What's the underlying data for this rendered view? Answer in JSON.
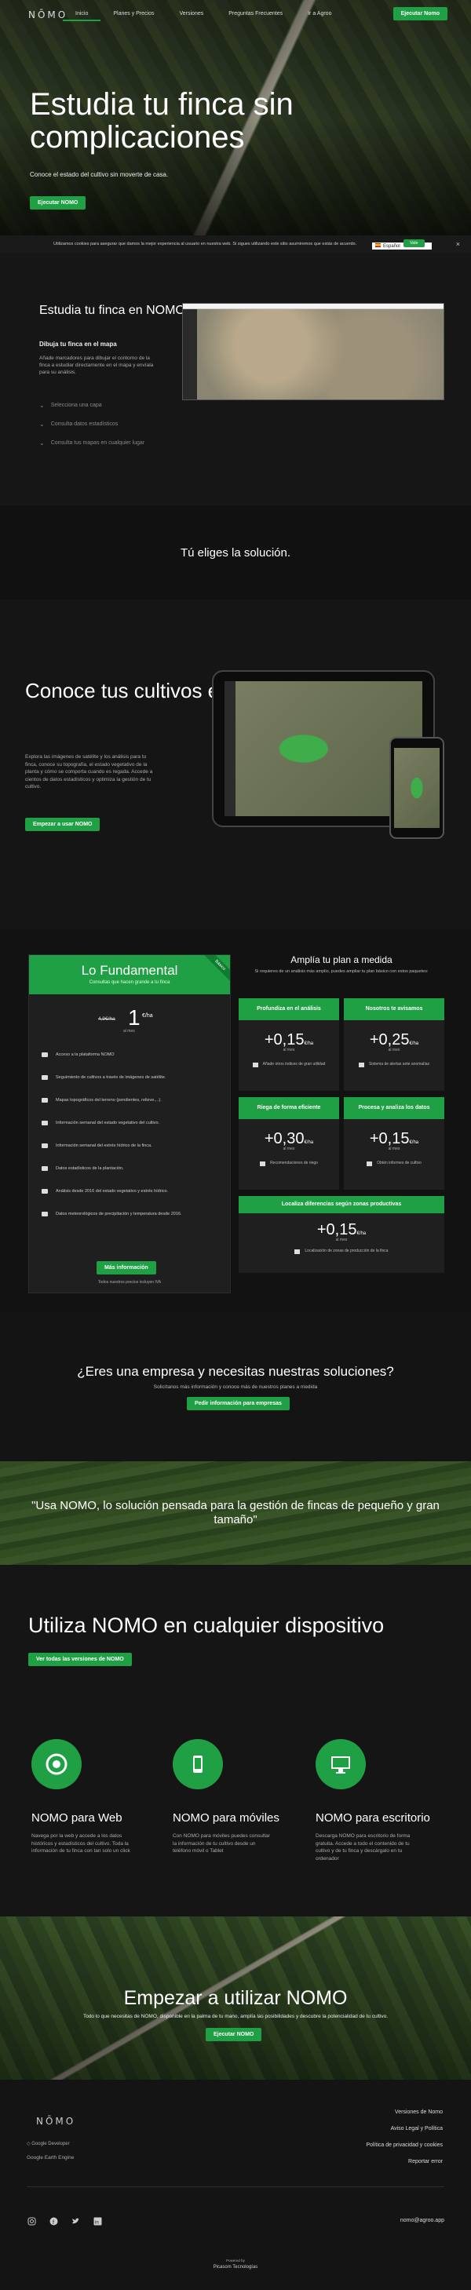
{
  "nav": {
    "logo": "NŌMO",
    "links": [
      "Inicio",
      "Planes y Precios",
      "Versiones",
      "Preguntas Frecuentes",
      "Ir a Agroo"
    ],
    "cta": "Ejecutar Nomo"
  },
  "hero": {
    "title": "Estudia tu finca sin complicaciones",
    "subtitle": "Conoce el estado del cultivo sin moverte de casa.",
    "cta": "Ejecutar NOMO"
  },
  "cookie": {
    "text": "Utilizamos cookies para asegurar que damos la mejor experiencia al usuario en nuestra web. Si sigues utilizando este sitio asumiremos que estás de acuerdo.",
    "accept": "Vale",
    "language": "Español",
    "close": "×"
  },
  "study": {
    "title": "Estudia tu finca en NOMO",
    "subtitle": "Dibuja tu finca en el mapa",
    "body": "Añade marcadores para dibujar el contorno de la finca a estudiar directamente en el mapa y envíala para su análisis.",
    "features": [
      "Selecciona una capa",
      "Consulta datos estadísticos",
      "Consulta tus mapas en cualquier lugar"
    ]
  },
  "tagline": "Tú eliges la solución.",
  "know": {
    "title": "Conoce tus cultivos en profundidad",
    "body": "Explora las imágenes de satélite y los análisis para tu finca, conoce su topografía, el estado vegetativo de la planta y cómo se comporta cuando es regada. Accede a cientos de datos estadísticos y optimiza la gestión de tu cultivo.",
    "cta": "Empezar a usar NOMO"
  },
  "plan": {
    "name": "Lo Fundamental",
    "sub": "Consultas que hacen grande a tu finca",
    "ribbon": "Básico",
    "old_price": "4,9€/ha",
    "price": "1",
    "unit": "€/ha",
    "per": "al mes",
    "features": [
      "Acceso a la plataforma NOMO",
      "Seguimiento de cultivos a través de imágenes de satélite.",
      "Mapas topográficos del terreno (pendientes, relieve,...).",
      "Información semanal del estado vegetativo del cultivo.",
      "Información semanal del estrés hídrico de la finca.",
      "Datos estadísticos de la plantación.",
      "Análisis desde 2016 del estado vegetativo y estrés hídrico.",
      "Datos meteorológicos de precipitación y temperatura desde 2016."
    ],
    "cta": "Más información",
    "note": "Todos nuestros precios incluyen IVA"
  },
  "expand": {
    "title": "Amplía tu plan a medida",
    "sub": "Si requieres de un análisis más amplio, puedes ampliar tu plan básico con estos paquetes:",
    "addons": [
      {
        "title": "Profundiza en el análisis",
        "value": "+0,15",
        "unit": "€/ha",
        "per": "al mes",
        "desc": "Añade otros índices de gran utilidad"
      },
      {
        "title": "Nosotros te avisamos",
        "value": "+0,25",
        "unit": "€/ha",
        "per": "al mes",
        "desc": "Sistema de alertas ante anomalías"
      },
      {
        "title": "Riega de forma eficiente",
        "value": "+0,30",
        "unit": "€/ha",
        "per": "al mes",
        "desc": "Recomendaciones de riego"
      },
      {
        "title": "Procesa y analiza los datos",
        "value": "+0,15",
        "unit": "€/ha",
        "per": "al mes",
        "desc": "Obtén informes de cultivo"
      },
      {
        "title": "Localiza diferencias según zonas productivas",
        "value": "+0,15",
        "unit": "€/ha",
        "per": "al mes",
        "desc": "Localización de zonas de producción de la finca"
      }
    ]
  },
  "company": {
    "title": "¿Eres una empresa y necesitas nuestras soluciones?",
    "sub": "Solicítanos más información y conoce más de nuestros planes a medida",
    "cta": "Pedir información para empresas"
  },
  "quote": "\"Usa NOMO, lo solución pensada para la gestión de fincas de pequeño y gran tamaño\"",
  "devices": {
    "title": "Utiliza NOMO en cualquier dispositivo",
    "cta": "Ver todas las versiones de NOMO",
    "items": [
      {
        "title": "NOMO para Web",
        "body": "Navega por la web y accede a los datos históricos y estadísticos del cultivo. Toda la información de tu finca con tan solo un click"
      },
      {
        "title": "NOMO para móviles",
        "body": "Con NOMO para móviles puedes consultar la información de tu cultivo desde un teléfono móvil o Tablet"
      },
      {
        "title": "NOMO para escritorio",
        "body": "Descarga NOMO para escritorio de forma gratuita. Accede a todo el contenido de tu cultivo y de tu finca y descárgalo en tu ordenador"
      }
    ]
  },
  "start": {
    "title": "Empezar a utilizar NOMO",
    "sub": "Todo lo que necesitas de NOMO, disponible en la palma de tu mano, amplía las posibilidades y descubre la potencialidad de tu cultivo.",
    "cta": "Ejecutar NOMO"
  },
  "footer": {
    "logo": "NŌMO",
    "partner1": "Google Developer",
    "partner2": "Google Earth Engine",
    "links": [
      "Versiones de Nomo",
      "Aviso Legal y Política",
      "Política de privacidad y cookies",
      "Reportar error"
    ],
    "email": "nomo@agroo.app",
    "powered": "Powered by",
    "company": "Picasom Tecnologías"
  },
  "colors": {
    "accent": "#1fa045"
  }
}
